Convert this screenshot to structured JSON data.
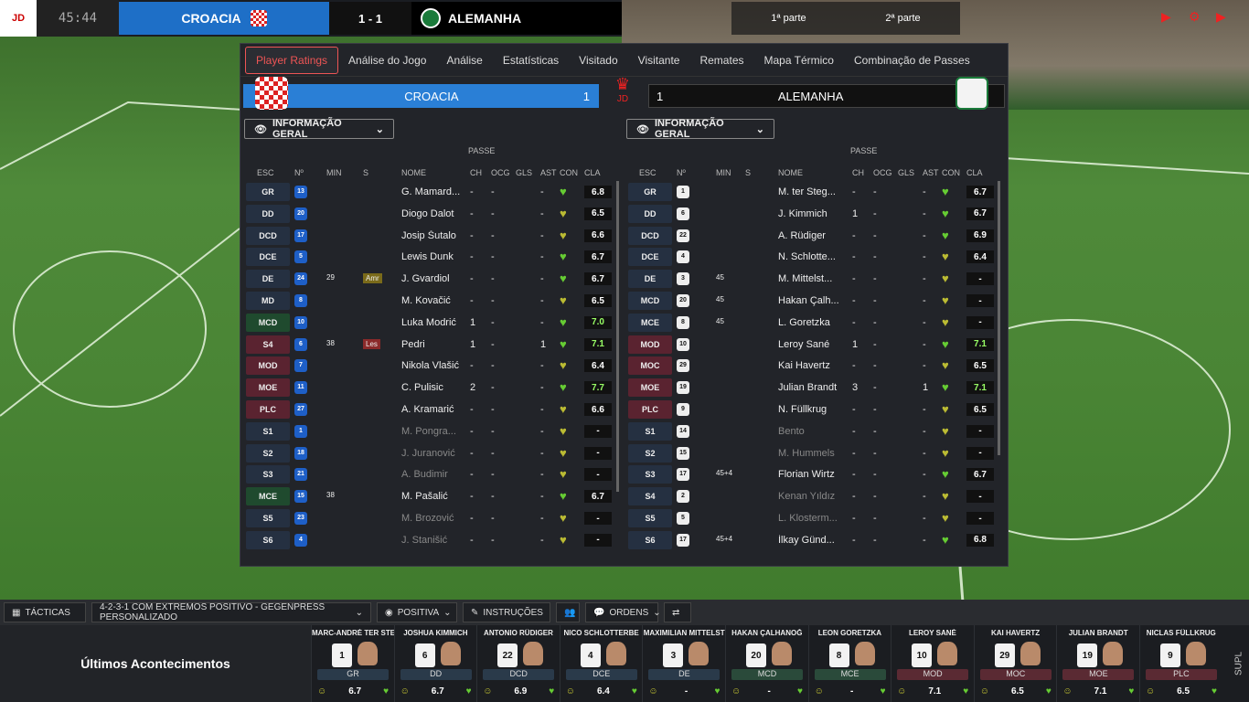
{
  "match": {
    "clock": "45:44",
    "home_team": "CROACIA",
    "away_team": "ALEMANHA",
    "score": "1 - 1",
    "timeline_half": "1ª parte",
    "timeline_2nd": "2ª parte"
  },
  "tabs": [
    "Player Ratings",
    "Análise do Jogo",
    "Análise",
    "Estatísticas",
    "Visitado",
    "Visitante",
    "Remates",
    "Mapa Térmico",
    "Combinação de Passes"
  ],
  "panel": {
    "home_name": "CROACIA",
    "home_goals": "1",
    "away_name": "ALEMANHA",
    "away_goals": "1",
    "center_logo": "JD",
    "dropdown_label": "INFORMAÇÃO GERAL",
    "passe_header": "PASSE"
  },
  "columns": [
    "ESC",
    "Nº",
    "MIN",
    "S",
    "NOME",
    "CH",
    "OCG",
    "GLS",
    "AST",
    "CON",
    "CLA"
  ],
  "home_players": [
    {
      "pos": "GR",
      "num": "13",
      "min": "",
      "s": "",
      "name": "G. Mamard...",
      "ch": "-",
      "ocg": "-",
      "gls": "",
      "ast": "-",
      "cla": "6.8",
      "t": "g"
    },
    {
      "pos": "DD",
      "num": "20",
      "min": "",
      "s": "",
      "name": "Diogo Dalot",
      "ch": "-",
      "ocg": "-",
      "gls": "",
      "ast": "-",
      "cla": "6.5",
      "t": "g"
    },
    {
      "pos": "DCD",
      "num": "17",
      "min": "",
      "s": "",
      "name": "Josip Šutalo",
      "ch": "-",
      "ocg": "-",
      "gls": "",
      "ast": "-",
      "cla": "6.6",
      "t": "g"
    },
    {
      "pos": "DCE",
      "num": "5",
      "min": "",
      "s": "",
      "name": "Lewis Dunk",
      "ch": "-",
      "ocg": "-",
      "gls": "",
      "ast": "-",
      "cla": "6.7",
      "t": "g"
    },
    {
      "pos": "DE",
      "num": "24",
      "min": "29",
      "s": "Amr",
      "name": "J. Gvardiol",
      "ch": "-",
      "ocg": "-",
      "gls": "",
      "ast": "-",
      "cla": "6.7",
      "t": "g"
    },
    {
      "pos": "MD",
      "num": "8",
      "min": "",
      "s": "",
      "name": "M. Kovačić",
      "ch": "-",
      "ocg": "-",
      "gls": "",
      "ast": "-",
      "cla": "6.5",
      "t": "g"
    },
    {
      "pos": "MCD",
      "num": "10",
      "min": "",
      "s": "",
      "name": "Luka Modrić",
      "ch": "1",
      "ocg": "-",
      "gls": "",
      "ast": "-",
      "cla": "7.0",
      "t": "gr"
    },
    {
      "pos": "S4",
      "num": "6",
      "min": "38",
      "s": "Les",
      "name": "Pedri",
      "ch": "1",
      "ocg": "-",
      "gls": "",
      "ast": "1",
      "cla": "7.1",
      "t": "r"
    },
    {
      "pos": "MOD",
      "num": "7",
      "min": "",
      "s": "",
      "name": "Nikola Vlašić",
      "ch": "-",
      "ocg": "-",
      "gls": "",
      "ast": "-",
      "cla": "6.4",
      "t": "r"
    },
    {
      "pos": "MOE",
      "num": "11",
      "min": "",
      "s": "",
      "name": "C. Pulisic",
      "ch": "2",
      "ocg": "-",
      "gls": "",
      "ast": "-",
      "cla": "7.7",
      "t": "r"
    },
    {
      "pos": "PLC",
      "num": "27",
      "min": "",
      "s": "",
      "name": "A. Kramarić",
      "ch": "-",
      "ocg": "-",
      "gls": "",
      "ast": "-",
      "cla": "6.6",
      "t": "r"
    },
    {
      "pos": "S1",
      "num": "1",
      "min": "",
      "s": "",
      "name": "M. Pongra...",
      "ch": "-",
      "ocg": "-",
      "gls": "",
      "ast": "-",
      "cla": "-",
      "t": "g"
    },
    {
      "pos": "S2",
      "num": "18",
      "min": "",
      "s": "",
      "name": "J. Juranović",
      "ch": "-",
      "ocg": "-",
      "gls": "",
      "ast": "-",
      "cla": "-",
      "t": "g"
    },
    {
      "pos": "S3",
      "num": "21",
      "min": "",
      "s": "",
      "name": "A. Budimir",
      "ch": "-",
      "ocg": "-",
      "gls": "",
      "ast": "-",
      "cla": "-",
      "t": "g"
    },
    {
      "pos": "MCE",
      "num": "15",
      "min": "38",
      "s": "",
      "name": "M. Pašalić",
      "ch": "-",
      "ocg": "-",
      "gls": "",
      "ast": "-",
      "cla": "6.7",
      "t": "gr"
    },
    {
      "pos": "S5",
      "num": "23",
      "min": "",
      "s": "",
      "name": "M. Brozović",
      "ch": "-",
      "ocg": "-",
      "gls": "",
      "ast": "-",
      "cla": "-",
      "t": "g"
    },
    {
      "pos": "S6",
      "num": "4",
      "min": "",
      "s": "",
      "name": "J. Stanišić",
      "ch": "-",
      "ocg": "-",
      "gls": "",
      "ast": "-",
      "cla": "-",
      "t": "g"
    }
  ],
  "away_players": [
    {
      "pos": "GR",
      "num": "1",
      "min": "",
      "name": "M. ter Steg...",
      "ch": "-",
      "ocg": "-",
      "gls": "",
      "ast": "-",
      "cla": "6.7",
      "t": "g"
    },
    {
      "pos": "DD",
      "num": "6",
      "min": "",
      "name": "J. Kimmich",
      "ch": "1",
      "ocg": "-",
      "gls": "",
      "ast": "-",
      "cla": "6.7",
      "t": "g"
    },
    {
      "pos": "DCD",
      "num": "22",
      "min": "",
      "name": "A. Rüdiger",
      "ch": "-",
      "ocg": "-",
      "gls": "",
      "ast": "-",
      "cla": "6.9",
      "t": "g"
    },
    {
      "pos": "DCE",
      "num": "4",
      "min": "",
      "name": "N. Schlotte...",
      "ch": "-",
      "ocg": "-",
      "gls": "",
      "ast": "-",
      "cla": "6.4",
      "t": "g"
    },
    {
      "pos": "DE",
      "num": "3",
      "min": "45",
      "name": "M. Mittelst...",
      "ch": "-",
      "ocg": "-",
      "gls": "",
      "ast": "-",
      "cla": "-",
      "t": "g"
    },
    {
      "pos": "MCD",
      "num": "20",
      "min": "45",
      "name": "Hakan Çalh...",
      "ch": "-",
      "ocg": "-",
      "gls": "",
      "ast": "-",
      "cla": "-",
      "t": "g"
    },
    {
      "pos": "MCE",
      "num": "8",
      "min": "45",
      "name": "L. Goretzka",
      "ch": "-",
      "ocg": "-",
      "gls": "",
      "ast": "-",
      "cla": "-",
      "t": "g"
    },
    {
      "pos": "MOD",
      "num": "10",
      "min": "",
      "name": "Leroy Sané",
      "ch": "1",
      "ocg": "-",
      "gls": "",
      "ast": "-",
      "cla": "7.1",
      "t": "r"
    },
    {
      "pos": "MOC",
      "num": "29",
      "min": "",
      "name": "Kai Havertz",
      "ch": "-",
      "ocg": "-",
      "gls": "",
      "ast": "-",
      "cla": "6.5",
      "t": "r"
    },
    {
      "pos": "MOE",
      "num": "19",
      "min": "",
      "name": "Julian Brandt",
      "ch": "3",
      "ocg": "-",
      "gls": "",
      "ast": "1",
      "cla": "7.1",
      "t": "r"
    },
    {
      "pos": "PLC",
      "num": "9",
      "min": "",
      "name": "N. Füllkrug",
      "ch": "-",
      "ocg": "-",
      "gls": "",
      "ast": "-",
      "cla": "6.5",
      "t": "r"
    },
    {
      "pos": "S1",
      "num": "14",
      "min": "",
      "name": "Bento",
      "ch": "-",
      "ocg": "-",
      "gls": "",
      "ast": "-",
      "cla": "-",
      "t": "g"
    },
    {
      "pos": "S2",
      "num": "15",
      "min": "",
      "name": "M. Hummels",
      "ch": "-",
      "ocg": "-",
      "gls": "",
      "ast": "-",
      "cla": "-",
      "t": "g"
    },
    {
      "pos": "S3",
      "num": "17",
      "min": "45+4",
      "name": "Florian Wirtz",
      "ch": "-",
      "ocg": "-",
      "gls": "",
      "ast": "-",
      "cla": "6.7",
      "t": "g"
    },
    {
      "pos": "S4",
      "num": "2",
      "min": "",
      "name": "Kenan Yıldız",
      "ch": "-",
      "ocg": "-",
      "gls": "",
      "ast": "-",
      "cla": "-",
      "t": "g"
    },
    {
      "pos": "S5",
      "num": "5",
      "min": "",
      "name": "L. Klosterm...",
      "ch": "-",
      "ocg": "-",
      "gls": "",
      "ast": "-",
      "cla": "-",
      "t": "g"
    },
    {
      "pos": "S6",
      "num": "17",
      "min": "45+4",
      "name": "İlkay Günd...",
      "ch": "-",
      "ocg": "-",
      "gls": "",
      "ast": "-",
      "cla": "6.8",
      "t": "g"
    }
  ],
  "bottom_bar": {
    "tactics": "TÁCTICAS",
    "formation": "4-2-3-1 COM EXTREMOS POSITIVO - GEGENPRESS PERSONALIZADO",
    "mentality": "POSITIVA",
    "instructions": "INSTRUÇÕES",
    "orders": "ORDENS"
  },
  "lineup": {
    "title": "Últimos Acontecimentos",
    "supl": "SUPL",
    "cards": [
      {
        "name": "MARC-ANDRÉ TER STE",
        "num": "1",
        "pos": "GR",
        "rating": "6.7",
        "t": "d"
      },
      {
        "name": "JOSHUA KIMMICH",
        "num": "6",
        "pos": "DD",
        "rating": "6.7",
        "t": "d"
      },
      {
        "name": "ANTONIO RÜDIGER",
        "num": "22",
        "pos": "DCD",
        "rating": "6.9",
        "t": "d"
      },
      {
        "name": "NICO SCHLOTTERBE",
        "num": "4",
        "pos": "DCE",
        "rating": "6.4",
        "t": "d"
      },
      {
        "name": "MAXIMILIAN MITTELST",
        "num": "3",
        "pos": "DE",
        "rating": "-",
        "t": "d"
      },
      {
        "name": "HAKAN ÇALHANOĞ",
        "num": "20",
        "pos": "MCD",
        "rating": "-",
        "t": "m"
      },
      {
        "name": "LEON GORETZKA",
        "num": "8",
        "pos": "MCE",
        "rating": "-",
        "t": "m"
      },
      {
        "name": "LEROY SANÉ",
        "num": "10",
        "pos": "MOD",
        "rating": "7.1",
        "t": "a"
      },
      {
        "name": "KAI HAVERTZ",
        "num": "29",
        "pos": "MOC",
        "rating": "6.5",
        "t": "a"
      },
      {
        "name": "JULIAN BRANDT",
        "num": "19",
        "pos": "MOE",
        "rating": "7.1",
        "t": "a"
      },
      {
        "name": "NICLAS FÜLLKRUG",
        "num": "9",
        "pos": "PLC",
        "rating": "6.5",
        "t": "a"
      }
    ]
  }
}
